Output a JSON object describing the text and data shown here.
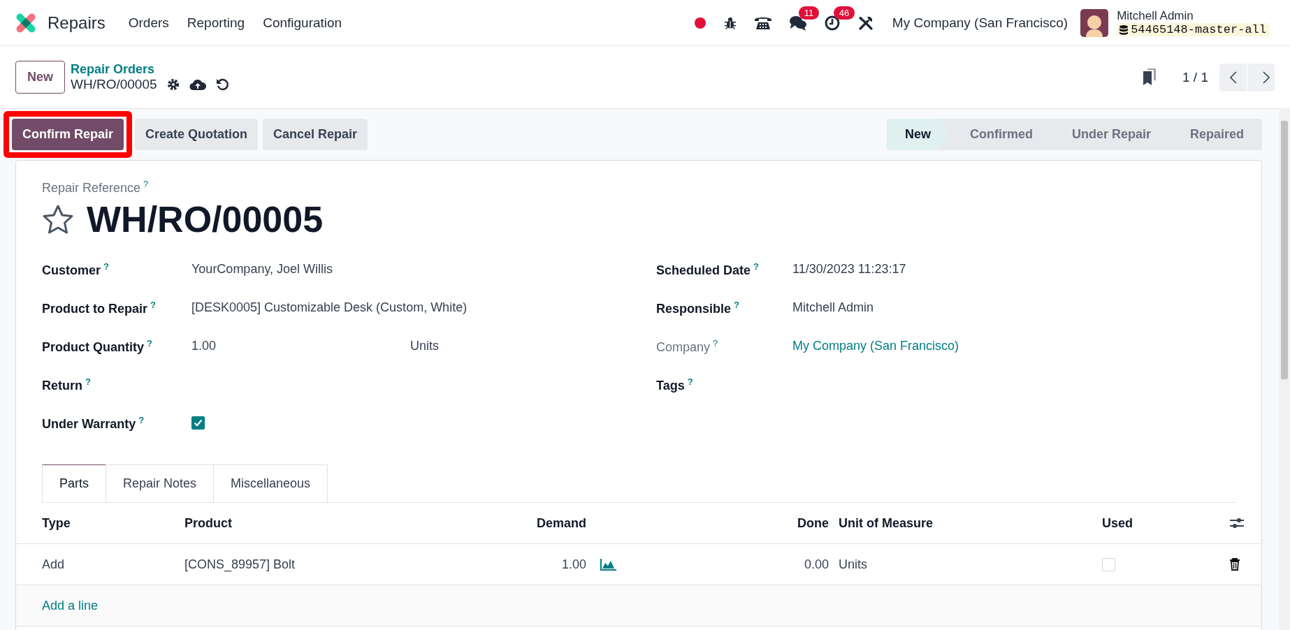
{
  "navbar": {
    "app_name": "Repairs",
    "menus": [
      "Orders",
      "Reporting",
      "Configuration"
    ],
    "systray": [
      {
        "kind": "record"
      },
      {
        "kind": "bug"
      },
      {
        "kind": "phone"
      },
      {
        "kind": "chat",
        "badge": "11"
      },
      {
        "kind": "clock",
        "badge": "46"
      },
      {
        "kind": "tools"
      }
    ],
    "company": "My Company (San Francisco)",
    "user": {
      "name": "Mitchell Admin",
      "database": "54465148-master-all"
    }
  },
  "control_panel": {
    "new_button": "New",
    "breadcrumb": "Repair Orders",
    "record": "WH/RO/00005",
    "pager": "1 / 1"
  },
  "actions": [
    {
      "label": "Confirm Repair",
      "primary": true,
      "highlighted": true
    },
    {
      "label": "Create Quotation",
      "primary": false,
      "highlighted": false
    },
    {
      "label": "Cancel Repair",
      "primary": false,
      "highlighted": false
    }
  ],
  "statusbar": [
    {
      "label": "New",
      "selected": true
    },
    {
      "label": "Confirmed",
      "selected": false
    },
    {
      "label": "Under Repair",
      "selected": false
    },
    {
      "label": "Repaired",
      "selected": false
    }
  ],
  "form": {
    "reference_label": "Repair Reference",
    "reference_help": "?",
    "reference": "WH/RO/00005",
    "starred": false,
    "left_fields": [
      {
        "kind": "text",
        "label": "Customer",
        "help": "?",
        "value": "YourCompany, Joel Willis"
      },
      {
        "kind": "text",
        "label": "Product to Repair",
        "help": "?",
        "value": "[DESK0005] Customizable Desk (Custom, White)"
      },
      {
        "kind": "quantity",
        "label": "Product Quantity",
        "help": "?",
        "value": "1.00",
        "unit": "Units"
      },
      {
        "kind": "empty",
        "label": "Return",
        "help": "?"
      },
      {
        "kind": "checkbox",
        "label": "Under Warranty",
        "help": "?",
        "checked": true
      }
    ],
    "right_fields": [
      {
        "kind": "text",
        "label": "Scheduled Date",
        "help": "?",
        "value": "11/30/2023 11:23:17"
      },
      {
        "kind": "text",
        "label": "Responsible",
        "help": "?",
        "value": "Mitchell Admin"
      },
      {
        "kind": "link",
        "label": "Company",
        "help": "?",
        "value": "My Company (San Francisco)",
        "readonly": true
      },
      {
        "kind": "empty",
        "label": "Tags",
        "help": "?"
      }
    ]
  },
  "tabs": [
    {
      "label": "Parts",
      "selected": true
    },
    {
      "label": "Repair Notes",
      "selected": false
    },
    {
      "label": "Miscellaneous",
      "selected": false
    }
  ],
  "table": {
    "columns": [
      "Type",
      "Product",
      "Demand",
      "Done",
      "Unit of Measure",
      "Used"
    ],
    "rows": [
      {
        "type": "Add",
        "product": "[CONS_89957] Bolt",
        "demand": "1.00",
        "done": "0.00",
        "uom": "Units",
        "used": false
      }
    ],
    "add_line": "Add a line"
  }
}
